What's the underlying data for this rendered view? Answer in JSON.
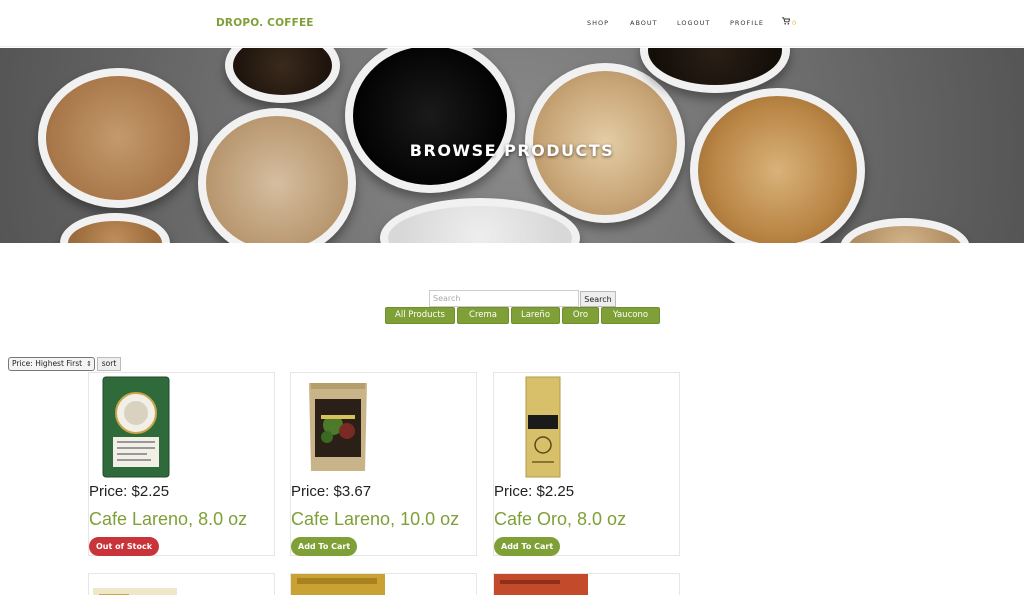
{
  "header": {
    "brand": "DROPO. COFFEE",
    "nav": [
      "SHOP",
      "ABOUT",
      "LOGOUT",
      "PROFILE"
    ],
    "cart_icon": "cart-icon",
    "cart_count": "0"
  },
  "hero": {
    "title": "BROWSE PRODUCTS"
  },
  "search": {
    "placeholder": "Search",
    "button": "Search"
  },
  "filters": [
    "All Products",
    "Crema",
    "Lareño",
    "Oro",
    "Yaucono"
  ],
  "sort": {
    "selected": "Price: Highest First",
    "button": "sort"
  },
  "products": [
    {
      "price": "Price: $2.25",
      "name": "Cafe Lareno, 8.0 oz",
      "button": "Out of Stock",
      "status_color": "#c9333a"
    },
    {
      "price": "Price: $3.67",
      "name": "Cafe Lareno, 10.0 oz",
      "button": "Add To Cart",
      "status_color": "#7ea037"
    },
    {
      "price": "Price: $2.25",
      "name": "Cafe Oro, 8.0 oz",
      "button": "Add To Cart",
      "status_color": "#7ea037"
    }
  ],
  "colors": {
    "accent": "#7ea037",
    "danger": "#c9333a"
  }
}
